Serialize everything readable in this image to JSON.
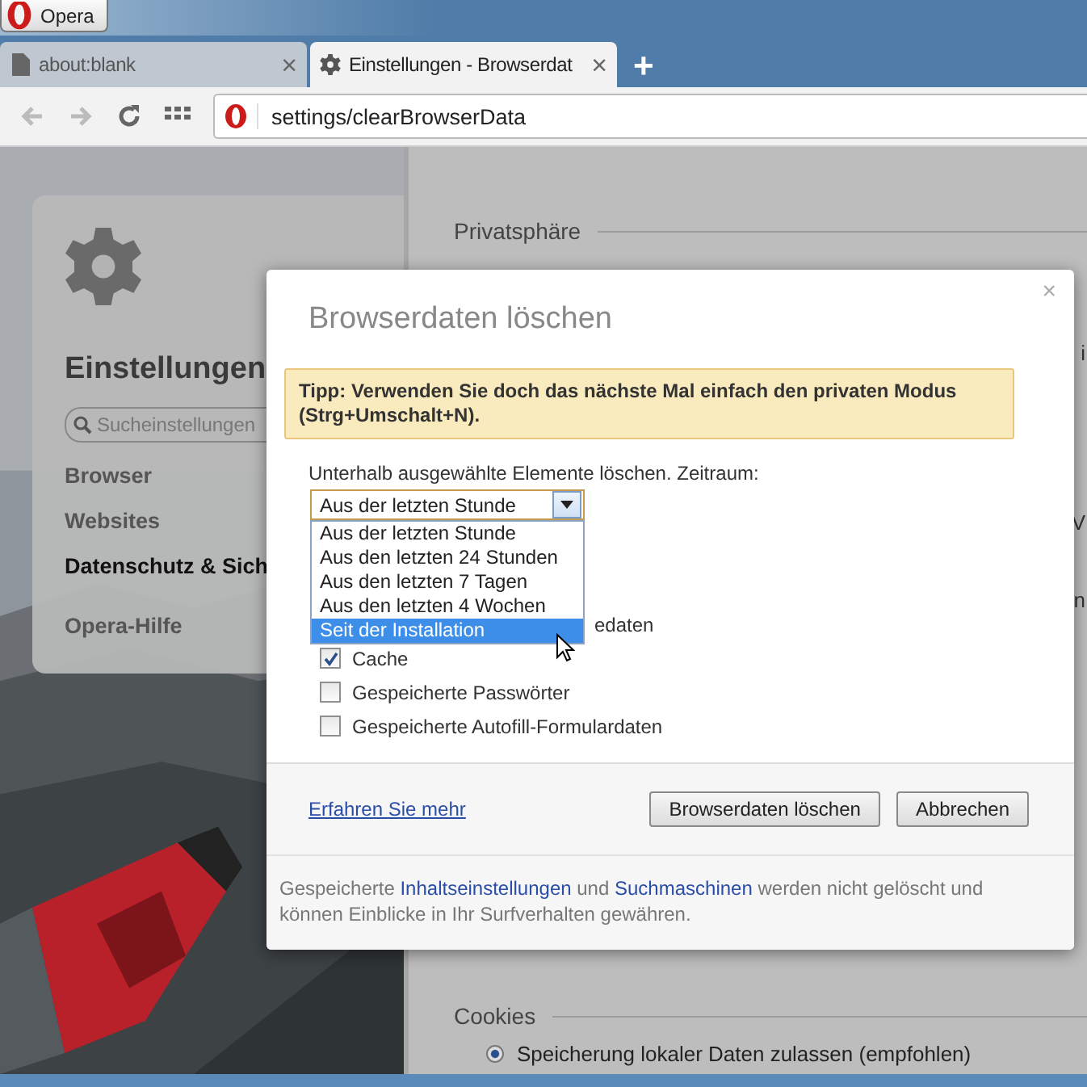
{
  "app_button": {
    "label": "Opera"
  },
  "tabs": [
    {
      "title": "about:blank",
      "selected": false,
      "close": "×"
    },
    {
      "title": "Einstellungen - Browserdat",
      "selected": true,
      "close": "×"
    }
  ],
  "new_tab": "+",
  "address_bar": {
    "url": "settings/clearBrowserData"
  },
  "sidebar": {
    "title": "Einstellungen",
    "search": {
      "placeholder": "Sucheinstellungen"
    },
    "items": [
      {
        "label": "Browser",
        "selected": false
      },
      {
        "label": "Websites",
        "selected": false
      },
      {
        "label": "Datenschutz & Sich",
        "selected": true
      },
      {
        "label": "Opera-Hilfe",
        "selected": false
      }
    ]
  },
  "settings_page": {
    "section": "Privatsphäre",
    "fragments": [
      "i",
      "V",
      "n"
    ],
    "cookies": {
      "title": "Cookies",
      "option": {
        "label": "Speicherung lokaler Daten zulassen (empfohlen)",
        "selected": true
      }
    }
  },
  "dialog": {
    "title": "Browserdaten löschen",
    "close": "×",
    "tip": "Tipp: Verwenden Sie doch das nächste Mal einfach den privaten Modus (Strg+Umschalt+N).",
    "period_label": "Unterhalb ausgewählte Elemente löschen. Zeitraum:",
    "period": {
      "value": "Aus der letzten Stunde",
      "expanded": true,
      "options": [
        {
          "label": "Aus der letzten Stunde",
          "highlighted": false
        },
        {
          "label": "Aus den letzten 24 Stunden",
          "highlighted": false
        },
        {
          "label": "Aus den letzten 7 Tagen",
          "highlighted": false
        },
        {
          "label": "Aus den letzten 4 Wochen",
          "highlighted": false
        },
        {
          "label": "Seit der Installation",
          "highlighted": true
        }
      ]
    },
    "covered_row_tail": "edaten",
    "checkboxes": [
      {
        "label": "Cache",
        "checked": true
      },
      {
        "label": "Gespeicherte Passwörter",
        "checked": false
      },
      {
        "label": "Gespeicherte Autofill-Formulardaten",
        "checked": false
      }
    ],
    "learn_more": "Erfahren Sie mehr",
    "buttons": [
      "Browserdaten löschen",
      "Abbrechen"
    ],
    "info": {
      "before": "Gespeicherte ",
      "link1": "Inhaltseinstellungen",
      "middle": " und ",
      "link2": "Suchmaschinen",
      "after": " werden nicht gelöscht und können Einblicke in Ihr Surfverhalten gewähren."
    }
  }
}
